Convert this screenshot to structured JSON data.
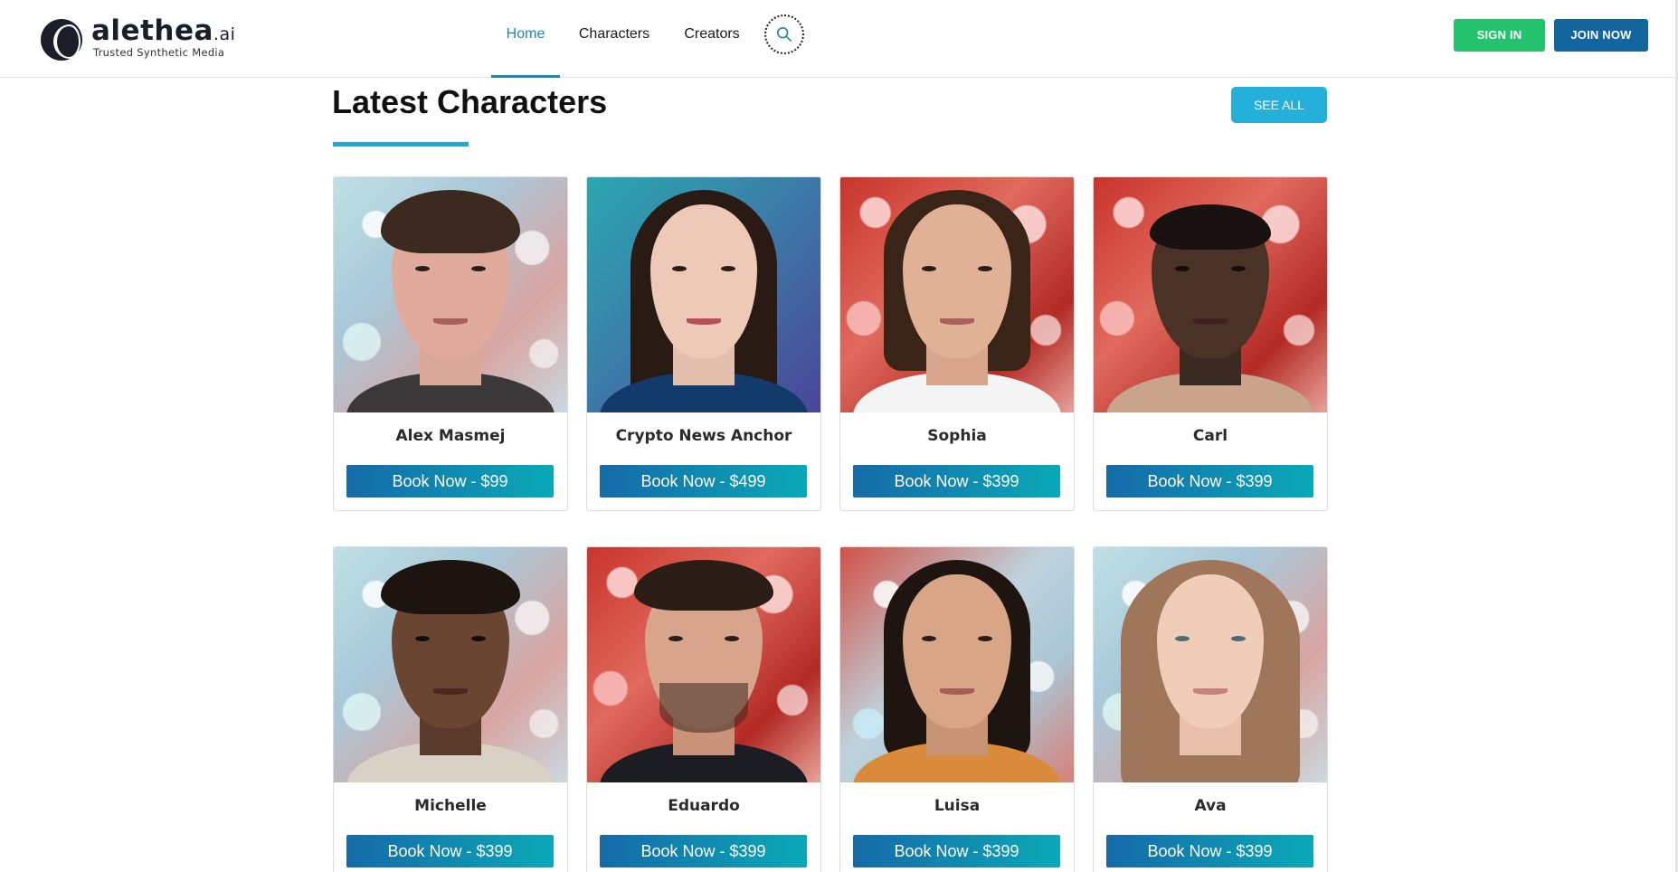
{
  "brand": {
    "name": "alethea",
    "suffix": ".ai",
    "tagline": "Trusted Synthetic Media",
    "logo_icon": "head-silhouette-icon"
  },
  "nav": {
    "home": "Home",
    "characters": "Characters",
    "creators": "Creators",
    "search_icon": "search-icon"
  },
  "auth": {
    "sign_in": "SIGN IN",
    "join_now": "JOIN NOW"
  },
  "colors": {
    "accent": "#1f86b4",
    "sign_in_bg": "#25c26e",
    "join_bg": "#13669d",
    "see_all_bg": "#25b0dc",
    "book_gradient_start": "#156aa8",
    "book_gradient_end": "#0aa9b7"
  },
  "section": {
    "title": "Latest Characters",
    "see_all": "SEE ALL"
  },
  "characters": [
    {
      "name": "Alex Masmej",
      "cta": "Book Now - $99"
    },
    {
      "name": "Crypto News Anchor",
      "cta": "Book Now - $499"
    },
    {
      "name": "Sophia",
      "cta": "Book Now - $399"
    },
    {
      "name": "Carl",
      "cta": "Book Now - $399"
    },
    {
      "name": "Michelle",
      "cta": "Book Now - $399"
    },
    {
      "name": "Eduardo",
      "cta": "Book Now - $399"
    },
    {
      "name": "Luisa",
      "cta": "Book Now - $399"
    },
    {
      "name": "Ava",
      "cta": "Book Now - $399"
    }
  ]
}
